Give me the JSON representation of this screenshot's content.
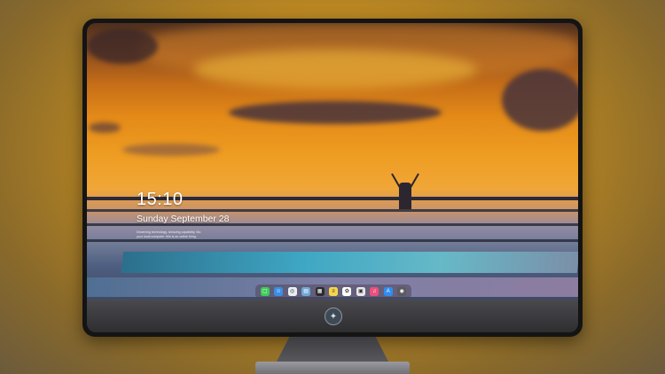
{
  "lock_screen": {
    "time": "15:10",
    "date": "Sunday September 28",
    "note_line1": "Deceiving technology. Amazing capability. Mo",
    "note_line2": "your local computer. this is an online thing."
  },
  "dock": {
    "apps": [
      {
        "name": "messages-icon",
        "glyph": "▢",
        "color": "#3ecb5a"
      },
      {
        "name": "finder-icon",
        "glyph": "☺",
        "color": "#3a8ee6"
      },
      {
        "name": "safari-icon",
        "glyph": "◎",
        "color": "#e9eef4"
      },
      {
        "name": "preview-icon",
        "glyph": "▤",
        "color": "#6fa8d8"
      },
      {
        "name": "clapper-icon",
        "glyph": "▦",
        "color": "#2c2c2e"
      },
      {
        "name": "notes-icon",
        "glyph": "≡",
        "color": "#f6d54a"
      },
      {
        "name": "photos-icon",
        "glyph": "✿",
        "color": "#ffffff"
      },
      {
        "name": "calendar-icon",
        "glyph": "▣",
        "color": "#e8e8ea"
      },
      {
        "name": "music-icon",
        "glyph": "♫",
        "color": "#ec4f7b"
      },
      {
        "name": "appstore-icon",
        "glyph": "A",
        "color": "#2f8ef2"
      },
      {
        "name": "camera-icon",
        "glyph": "◉",
        "color": "#5a5a60"
      }
    ]
  }
}
